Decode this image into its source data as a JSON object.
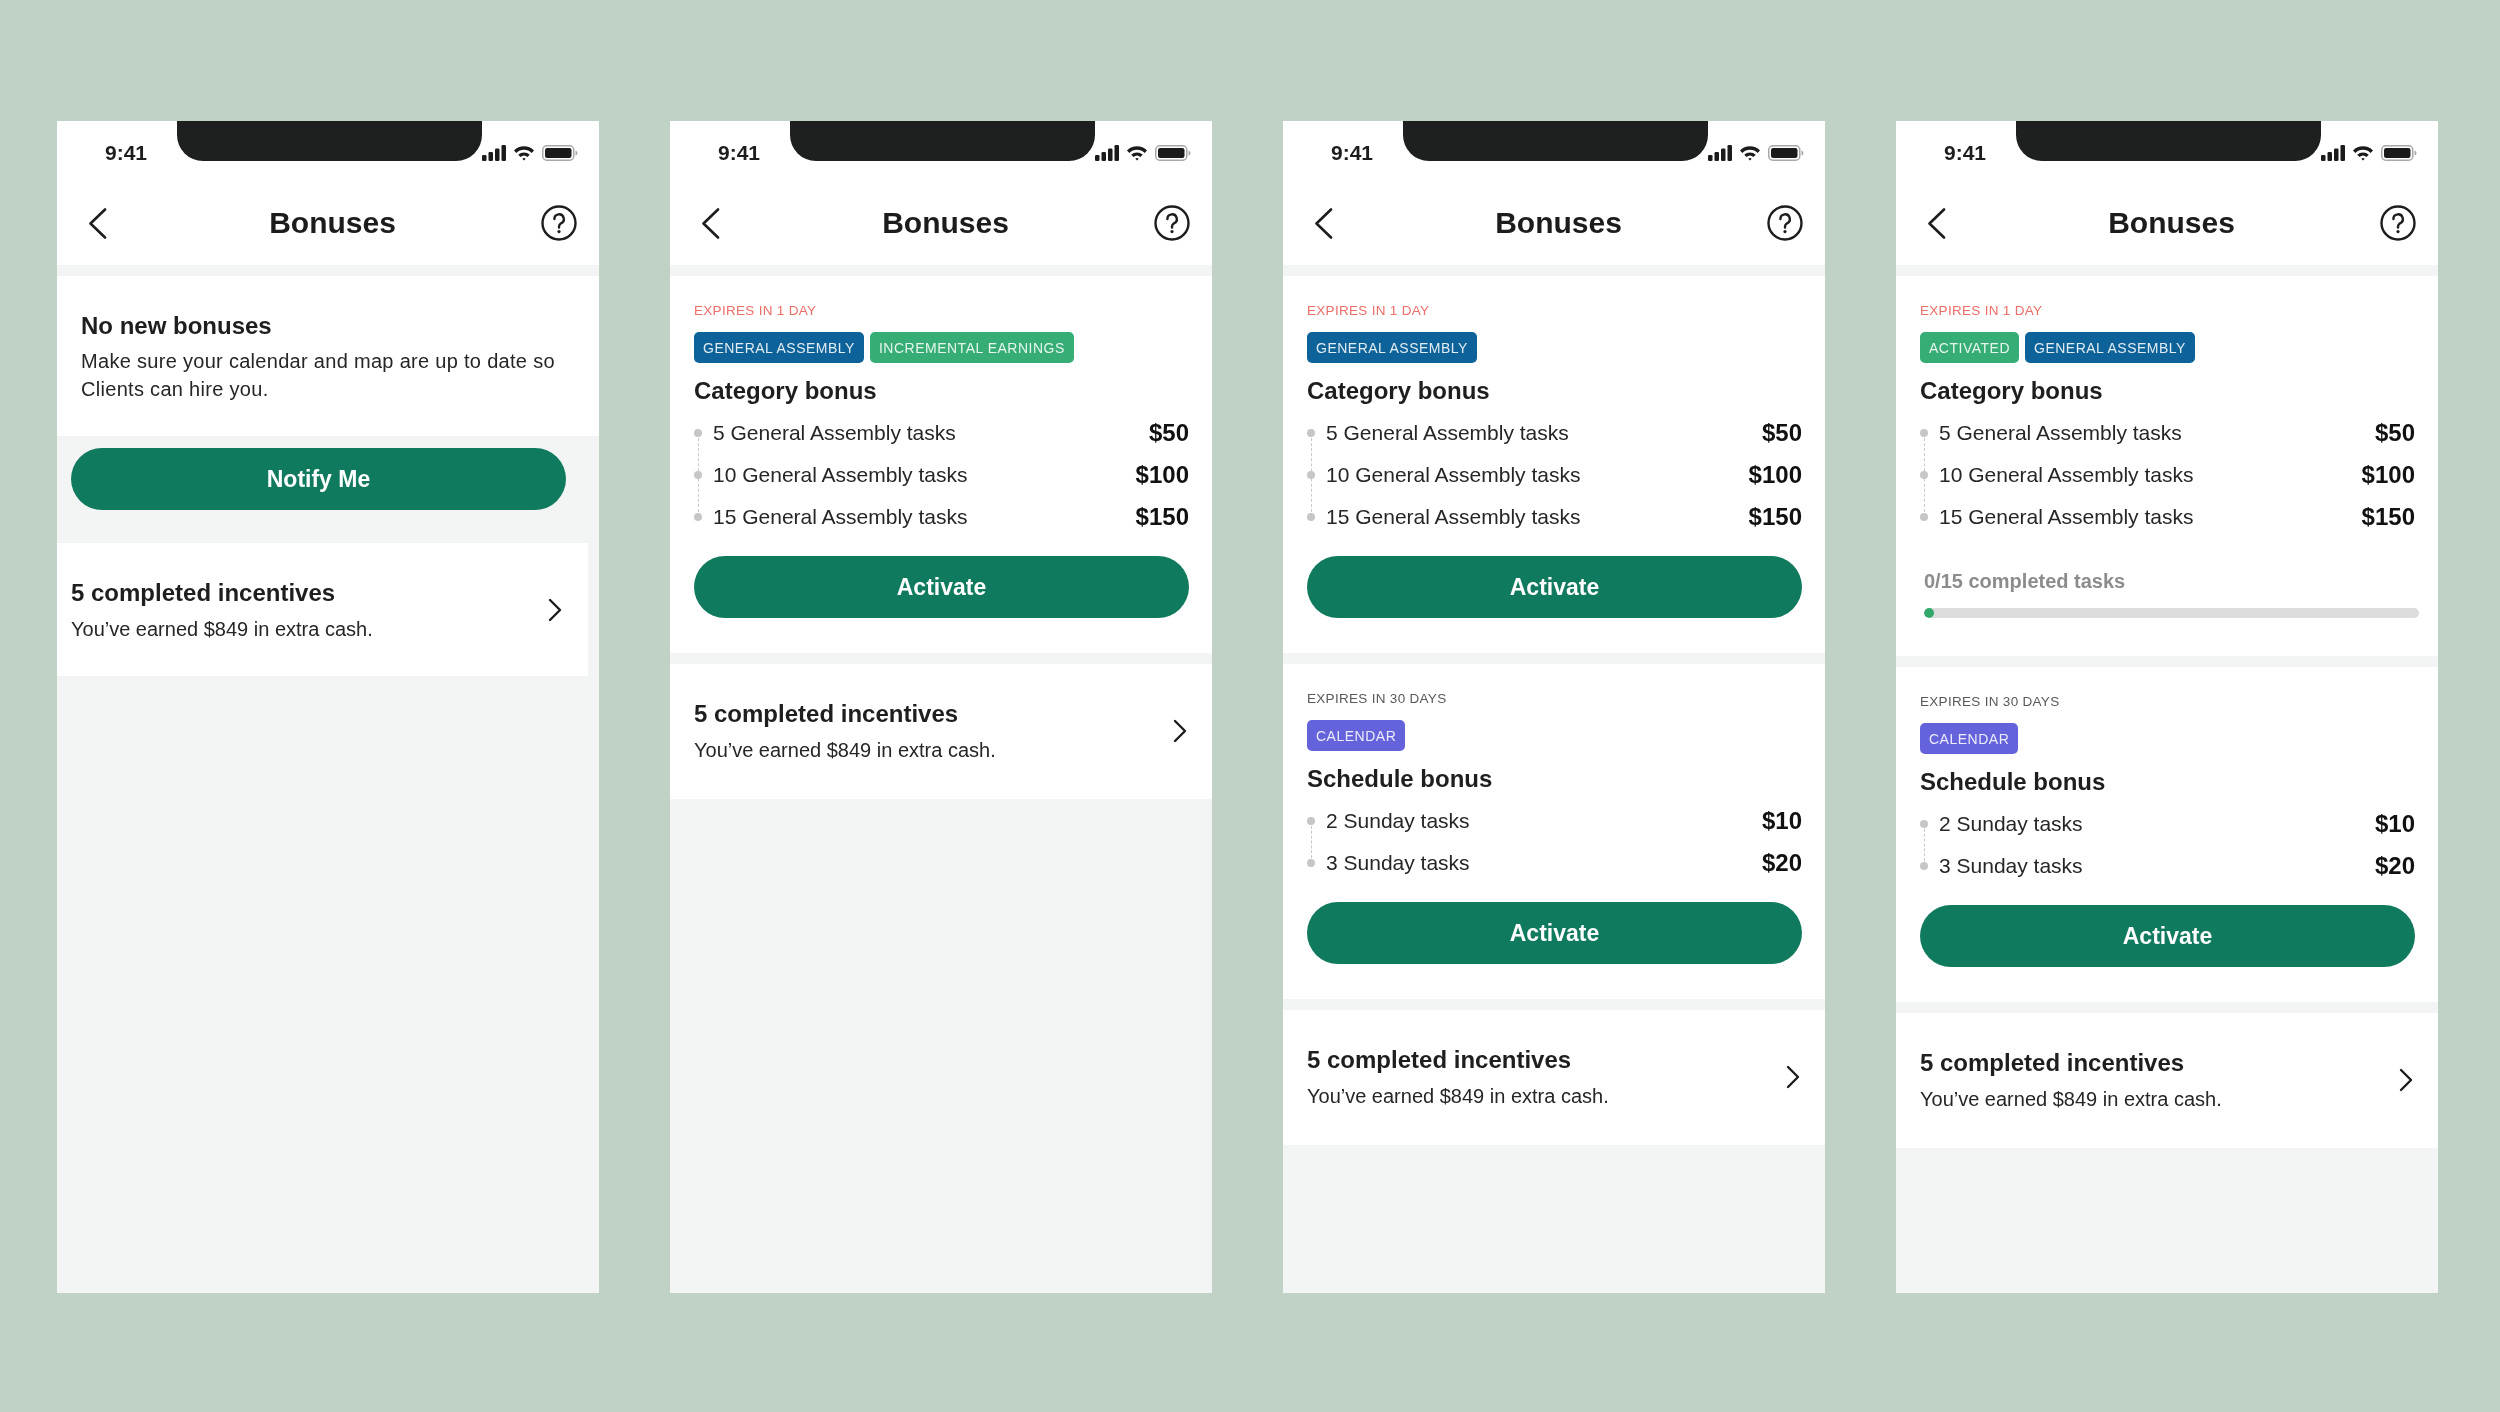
{
  "screens": [
    {
      "status_bar": {
        "time": "9:41"
      },
      "header": {
        "title": "Bonuses"
      },
      "empty_state": {
        "title": "No new bonuses",
        "message": "Make sure your calendar and map are up to date so Clients can hire you.",
        "button": "Notify Me"
      },
      "completed": {
        "title": "5 completed incentives",
        "subtitle": "You’ve earned $849 in extra cash."
      }
    },
    {
      "status_bar": {
        "time": "9:41"
      },
      "header": {
        "title": "Bonuses"
      },
      "bonuses": [
        {
          "expiry": "EXPIRES IN 1 DAY",
          "urgent": true,
          "tags": [
            {
              "label": "GENERAL ASSEMBLY",
              "color": "#0c6299"
            },
            {
              "label": "INCREMENTAL EARNINGS",
              "color": "#35ad74"
            }
          ],
          "title": "Category bonus",
          "tiers": [
            {
              "label": "5 General Assembly tasks",
              "amount": "$50"
            },
            {
              "label": "10 General Assembly tasks",
              "amount": "$100"
            },
            {
              "label": "15 General Assembly tasks",
              "amount": "$150"
            }
          ],
          "footer": {
            "kind": "button",
            "label": "Activate"
          }
        }
      ],
      "completed": {
        "title": "5 completed incentives",
        "subtitle": "You’ve earned $849 in extra cash."
      }
    },
    {
      "status_bar": {
        "time": "9:41"
      },
      "header": {
        "title": "Bonuses"
      },
      "bonuses": [
        {
          "expiry": "EXPIRES IN 1 DAY",
          "urgent": true,
          "tags": [
            {
              "label": "GENERAL ASSEMBLY",
              "color": "#0c6299"
            }
          ],
          "title": "Category bonus",
          "tiers": [
            {
              "label": "5 General Assembly tasks",
              "amount": "$50"
            },
            {
              "label": "10 General Assembly tasks",
              "amount": "$100"
            },
            {
              "label": "15 General Assembly tasks",
              "amount": "$150"
            }
          ],
          "footer": {
            "kind": "button",
            "label": "Activate"
          }
        },
        {
          "expiry": "EXPIRES IN 30 DAYS",
          "urgent": false,
          "tags": [
            {
              "label": "CALENDAR",
              "color": "#6463dc"
            }
          ],
          "title": "Schedule bonus",
          "tiers": [
            {
              "label": "2 Sunday tasks",
              "amount": "$10"
            },
            {
              "label": "3 Sunday tasks",
              "amount": "$20"
            }
          ],
          "footer": {
            "kind": "button",
            "label": "Activate"
          }
        }
      ],
      "completed": {
        "title": "5 completed incentives",
        "subtitle": "You’ve earned $849 in extra cash."
      }
    },
    {
      "status_bar": {
        "time": "9:41"
      },
      "header": {
        "title": "Bonuses"
      },
      "bonuses": [
        {
          "expiry": "EXPIRES IN 1 DAY",
          "urgent": true,
          "tags": [
            {
              "label": "ACTIVATED",
              "color": "#35ad74"
            },
            {
              "label": "GENERAL ASSEMBLY",
              "color": "#0c6299"
            }
          ],
          "title": "Category bonus",
          "tiers": [
            {
              "label": "5 General Assembly tasks",
              "amount": "$50"
            },
            {
              "label": "10 General Assembly tasks",
              "amount": "$100"
            },
            {
              "label": "15 General Assembly tasks",
              "amount": "$150"
            }
          ],
          "footer": {
            "kind": "progress",
            "label": "0/15 completed tasks",
            "level": 0
          }
        },
        {
          "expiry": "EXPIRES IN 30 DAYS",
          "urgent": false,
          "tags": [
            {
              "label": "CALENDAR",
              "color": "#6463dc"
            }
          ],
          "title": "Schedule bonus",
          "tiers": [
            {
              "label": "2 Sunday tasks",
              "amount": "$10"
            },
            {
              "label": "3 Sunday tasks",
              "amount": "$20"
            }
          ],
          "footer": {
            "kind": "button",
            "label": "Activate"
          }
        }
      ],
      "completed": {
        "title": "5 completed incentives",
        "subtitle": "You’ve earned $849 in extra cash."
      }
    }
  ]
}
